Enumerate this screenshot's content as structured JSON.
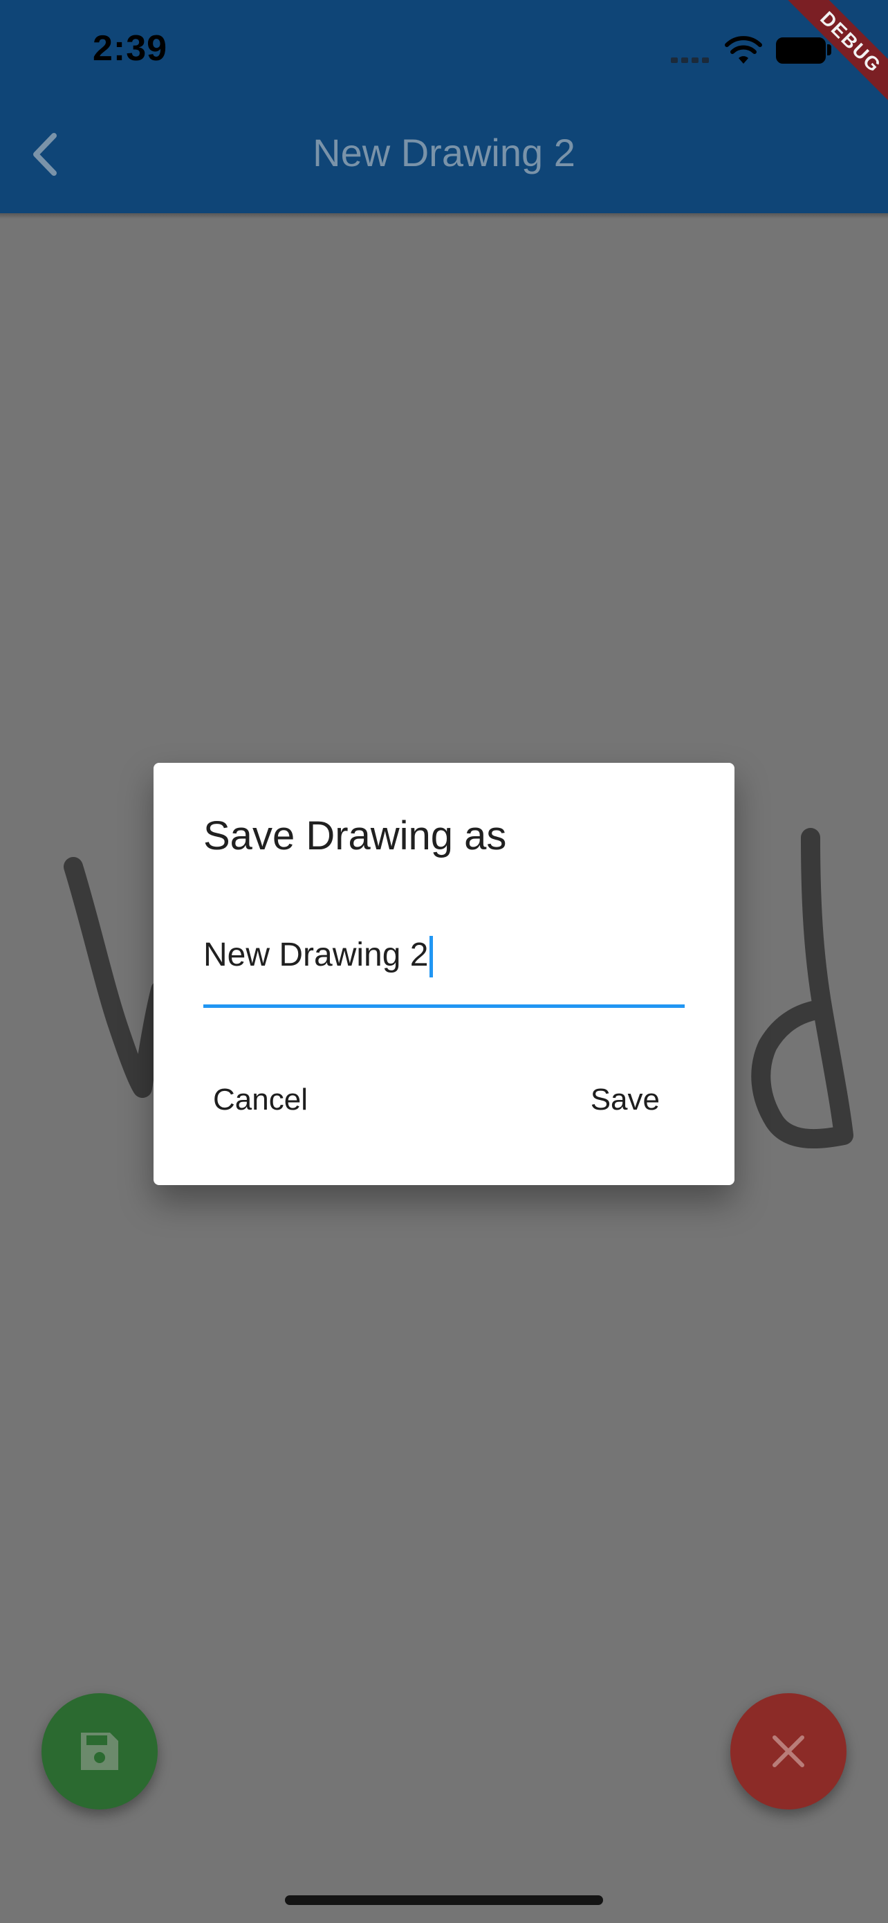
{
  "status_bar": {
    "time": "2:39"
  },
  "debug_banner": "DEBUG",
  "app_bar": {
    "title": "New Drawing 2",
    "back_icon": "chevron-left-icon"
  },
  "dialog": {
    "title": "Save Drawing as",
    "input_value": "New Drawing 2",
    "cancel_label": "Cancel",
    "save_label": "Save"
  },
  "fabs": {
    "save_icon": "floppy-disk-icon",
    "clear_icon": "close-icon"
  },
  "colors": {
    "app_bar": "#0f4577",
    "scrim_background": "#757575",
    "accent": "#2196f3",
    "save_fab": "#2b6a30",
    "clear_fab": "#8c2b27",
    "debug_banner": "#7b1f24",
    "stroke": "#3a3a3a"
  }
}
